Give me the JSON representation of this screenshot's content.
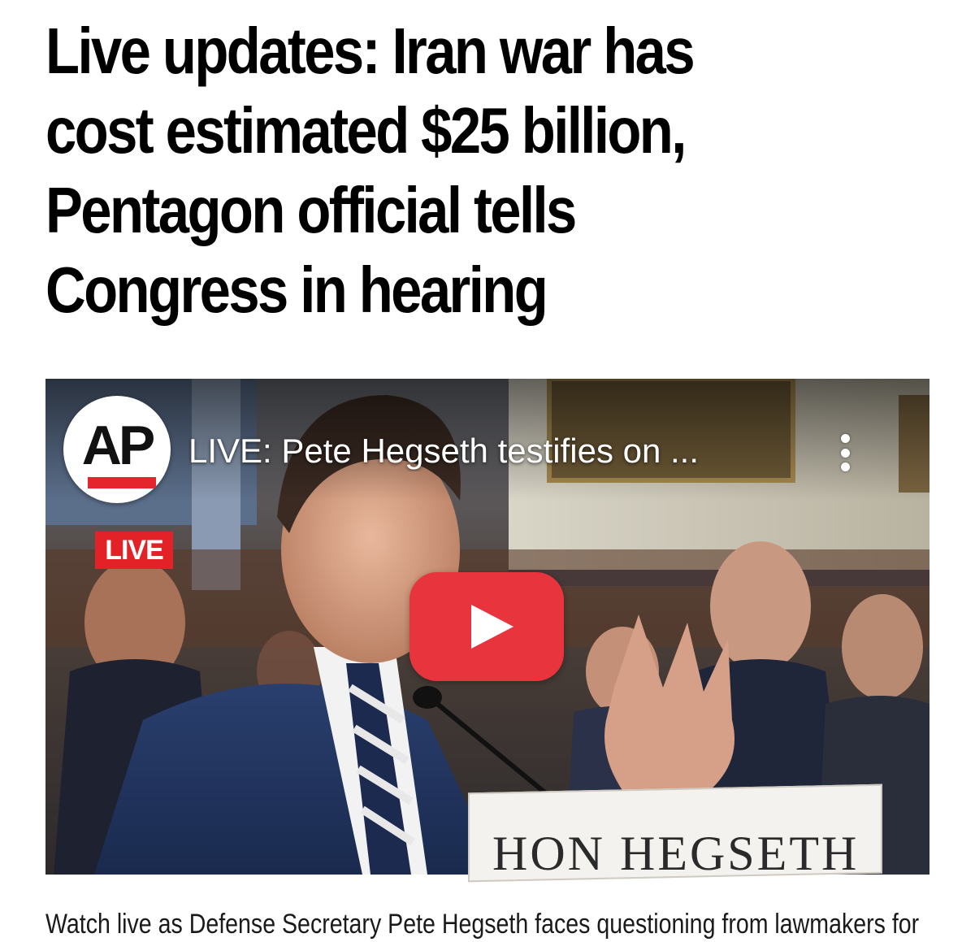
{
  "article": {
    "headline_lines": [
      "Live updates: Iran war has",
      "cost estimated $25 billion,",
      "Pentagon official tells",
      "Congress in hearing"
    ],
    "caption": "Watch live as Defense Secretary Pete Hegseth faces questioning from lawmakers for"
  },
  "video": {
    "channel_logo_text": "AP",
    "live_badge": "LIVE",
    "title": "LIVE: Pete Hegseth testifies on ...",
    "nameplate": "HON HEGSETH",
    "colors": {
      "play_button": "#e8343c",
      "live_badge": "#e22226",
      "logo_accent": "#e5252c"
    },
    "icons": {
      "menu": "more-vertical-icon",
      "play": "play-icon"
    }
  }
}
